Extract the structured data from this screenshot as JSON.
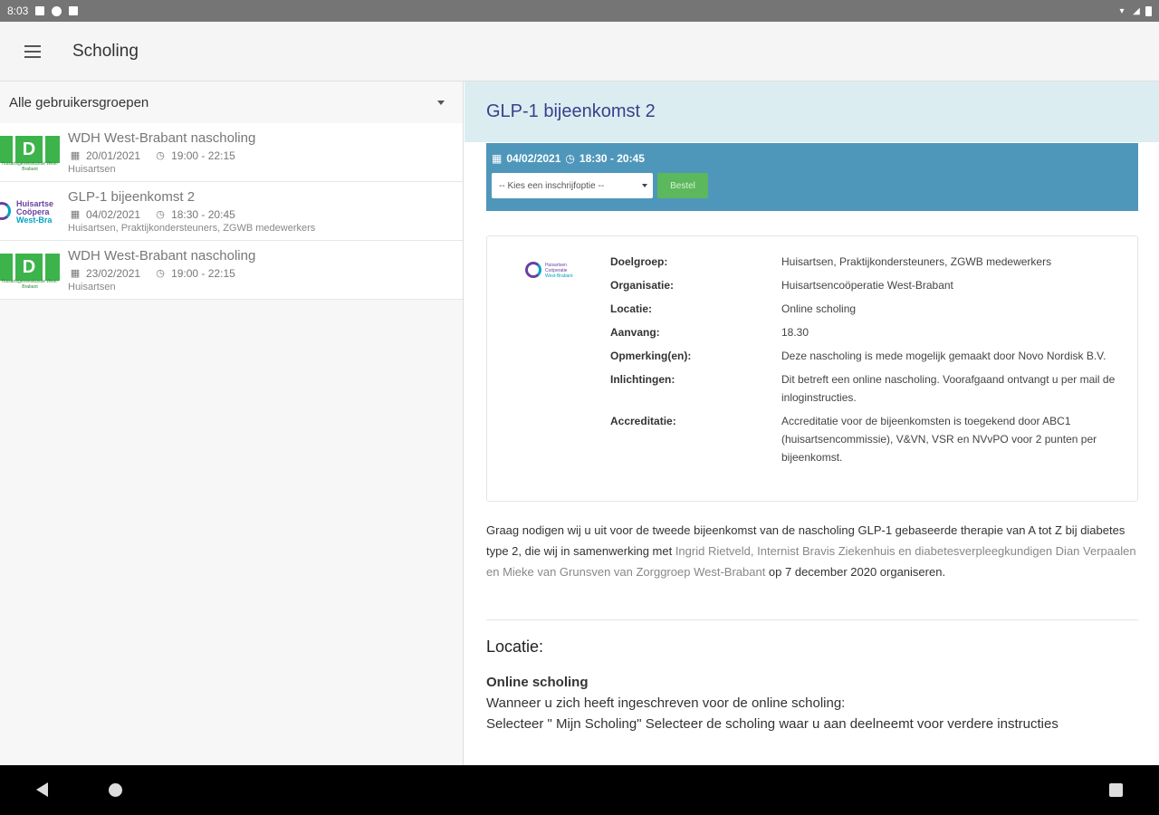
{
  "status_bar": {
    "time": "8:03"
  },
  "app_bar": {
    "title": "Scholing"
  },
  "left": {
    "group_filter": "Alle gebruikersgroepen",
    "events": [
      {
        "title": "WDH West-Brabant nascholing",
        "date": "20/01/2021",
        "time": "19:00 - 22:15",
        "groups": "Huisartsen",
        "logo": "wdh"
      },
      {
        "title": "GLP-1 bijeenkomst 2",
        "date": "04/02/2021",
        "time": "18:30 - 20:45",
        "groups": "Huisartsen, Praktijkondersteuners, ZGWB medewerkers",
        "logo": "huisartsencooperatie"
      },
      {
        "title": "WDH West-Brabant nascholing",
        "date": "23/02/2021",
        "time": "19:00 - 22:15",
        "groups": "Huisartsen",
        "logo": "wdh"
      }
    ],
    "wdh_logo": {
      "letter": "D",
      "caption": "Huisartsgeneeskunde West-Brabant"
    },
    "hc_logo": {
      "line1": "Huisartse",
      "line2": "Coöpera",
      "line3": "West-Bra"
    }
  },
  "detail": {
    "title": "GLP-1 bijeenkomst 2",
    "signup": {
      "date": "04/02/2021",
      "time": "18:30 - 20:45",
      "select_placeholder": "-- Kies een inschrijfoptie --",
      "order_label": "Bestel"
    },
    "card_logo": {
      "line1": "Huisartsen",
      "line2": "Coöperatie",
      "line3": "West-Brabant"
    },
    "info": [
      {
        "key": "Doelgroep:",
        "value": "Huisartsen, Praktijkondersteuners, ZGWB medewerkers"
      },
      {
        "key": "Organisatie:",
        "value": "Huisartsencoöperatie West-Brabant"
      },
      {
        "key": "Locatie:",
        "value": "Online scholing"
      },
      {
        "key": "Aanvang:",
        "value": "18.30"
      },
      {
        "key": "Opmerking(en):",
        "value": "Deze nascholing is mede mogelijk gemaakt door Novo Nordisk B.V."
      },
      {
        "key": "Inlichtingen:",
        "value": "Dit betreft een online nascholing. Voorafgaand ontvangt u per mail de inloginstructies."
      },
      {
        "key": "Accreditatie:",
        "value": "Accreditatie voor de bijeenkomsten is toegekend door ABC1 (huisartsencommissie), V&VN, VSR en NVvPO voor 2 punten per bijeenkomst."
      }
    ],
    "description": {
      "part1": "Graag nodigen wij u uit voor de tweede bijeenkomst van de nascholing GLP-1 gebaseerde therapie van A tot Z bij diabetes type 2, die wij in samenwerking met ",
      "link": "Ingrid Rietveld, Internist Bravis Ziekenhuis en diabetesverpleegkundigen Dian Verpaalen en Mieke van Grunsven van Zorggroep West-Brabant",
      "part2": " op 7 december 2020 organiseren."
    },
    "location_heading": "Locatie:",
    "location_name": "Online scholing",
    "location_line1": "Wanneer u zich heeft ingeschreven voor de online scholing:",
    "location_line2": "Selecteer \" Mijn Scholing\" Selecteer de scholing waar u aan deelneemt voor verdere instructies"
  },
  "colors": {
    "accent": "#4f97ba",
    "header_bg": "#dcedf1",
    "title": "#3a3f8c",
    "order": "#5cb85c"
  }
}
